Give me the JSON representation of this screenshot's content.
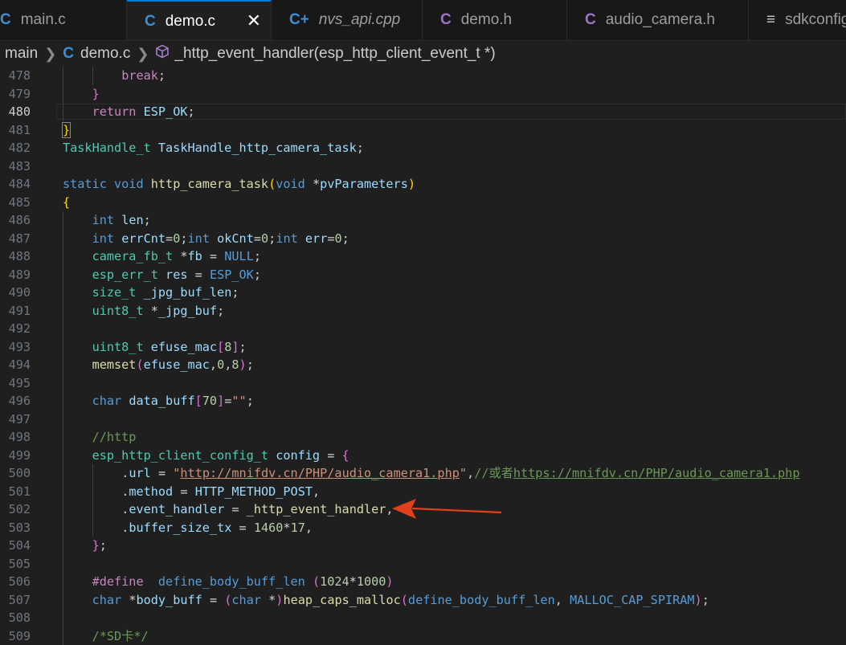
{
  "tabs": [
    {
      "label": "main.c",
      "icon": "C",
      "icon_color": "#3b8fd6",
      "italic": false,
      "active": false
    },
    {
      "label": "demo.c",
      "icon": "C",
      "icon_color": "#3b8fd6",
      "italic": false,
      "active": true
    },
    {
      "label": "nvs_api.cpp",
      "icon": "C+",
      "icon_color": "#3b8fd6",
      "italic": true,
      "active": false
    },
    {
      "label": "demo.h",
      "icon": "C",
      "icon_color": "#a074c4",
      "italic": false,
      "active": false
    },
    {
      "label": "audio_camera.h",
      "icon": "C",
      "icon_color": "#a074c4",
      "italic": false,
      "active": false
    },
    {
      "label": "sdkconfig",
      "icon": "≡",
      "icon_color": "#cccccc",
      "italic": false,
      "active": false
    }
  ],
  "breadcrumb": {
    "folder": "main",
    "file_icon": "C",
    "file": "demo.c",
    "symbol": "_http_event_handler(esp_http_client_event_t *)"
  },
  "current_line": 480,
  "lines": [
    {
      "n": 478,
      "indent": 2,
      "tokens": [
        [
          "ctl",
          "break"
        ],
        [
          "p",
          ";"
        ]
      ]
    },
    {
      "n": 479,
      "indent": 1,
      "tokens": [
        [
          "b2",
          "}"
        ]
      ]
    },
    {
      "n": 480,
      "indent": 1,
      "tokens": [
        [
          "ctl",
          "return"
        ],
        [
          "p",
          " "
        ],
        [
          "var",
          "ESP_OK"
        ],
        [
          "p",
          ";"
        ]
      ]
    },
    {
      "n": 481,
      "indent": 0,
      "tokens": [
        [
          "b1",
          "}"
        ]
      ]
    },
    {
      "n": 482,
      "indent": 0,
      "tokens": [
        [
          "ty",
          "TaskHandle_t"
        ],
        [
          "p",
          " "
        ],
        [
          "var",
          "TaskHandle_http_camera_task"
        ],
        [
          "p",
          ";"
        ]
      ]
    },
    {
      "n": 483,
      "indent": 0,
      "tokens": []
    },
    {
      "n": 484,
      "indent": 0,
      "tokens": [
        [
          "kw",
          "static"
        ],
        [
          "p",
          " "
        ],
        [
          "kw",
          "void"
        ],
        [
          "p",
          " "
        ],
        [
          "fn",
          "http_camera_task"
        ],
        [
          "b1",
          "("
        ],
        [
          "kw",
          "void"
        ],
        [
          "p",
          " "
        ],
        [
          "op",
          "*"
        ],
        [
          "var",
          "pvParameters"
        ],
        [
          "b1",
          ")"
        ]
      ]
    },
    {
      "n": 485,
      "indent": 0,
      "tokens": [
        [
          "b1",
          "{"
        ]
      ]
    },
    {
      "n": 486,
      "indent": 1,
      "tokens": [
        [
          "kw",
          "int"
        ],
        [
          "p",
          " "
        ],
        [
          "var",
          "len"
        ],
        [
          "p",
          ";"
        ]
      ]
    },
    {
      "n": 487,
      "indent": 1,
      "tokens": [
        [
          "kw",
          "int"
        ],
        [
          "p",
          " "
        ],
        [
          "var",
          "errCnt"
        ],
        [
          "op",
          "="
        ],
        [
          "num",
          "0"
        ],
        [
          "p",
          ";"
        ],
        [
          "kw",
          "int"
        ],
        [
          "p",
          " "
        ],
        [
          "var",
          "okCnt"
        ],
        [
          "op",
          "="
        ],
        [
          "num",
          "0"
        ],
        [
          "p",
          ";"
        ],
        [
          "kw",
          "int"
        ],
        [
          "p",
          " "
        ],
        [
          "var",
          "err"
        ],
        [
          "op",
          "="
        ],
        [
          "num",
          "0"
        ],
        [
          "p",
          ";"
        ]
      ]
    },
    {
      "n": 488,
      "indent": 1,
      "tokens": [
        [
          "ty",
          "camera_fb_t"
        ],
        [
          "p",
          " "
        ],
        [
          "op",
          "*"
        ],
        [
          "var",
          "fb"
        ],
        [
          "p",
          " "
        ],
        [
          "op",
          "="
        ],
        [
          "p",
          " "
        ],
        [
          "kw",
          "NULL"
        ],
        [
          "p",
          ";"
        ]
      ]
    },
    {
      "n": 489,
      "indent": 1,
      "tokens": [
        [
          "ty",
          "esp_err_t"
        ],
        [
          "p",
          " "
        ],
        [
          "var",
          "res"
        ],
        [
          "p",
          " "
        ],
        [
          "op",
          "="
        ],
        [
          "p",
          " "
        ],
        [
          "kw",
          "ESP_OK"
        ],
        [
          "p",
          ";"
        ]
      ]
    },
    {
      "n": 490,
      "indent": 1,
      "tokens": [
        [
          "ty",
          "size_t"
        ],
        [
          "p",
          " "
        ],
        [
          "var",
          "_jpg_buf_len"
        ],
        [
          "p",
          ";"
        ]
      ]
    },
    {
      "n": 491,
      "indent": 1,
      "tokens": [
        [
          "ty",
          "uint8_t"
        ],
        [
          "p",
          " "
        ],
        [
          "op",
          "*"
        ],
        [
          "var",
          "_jpg_buf"
        ],
        [
          "p",
          ";"
        ]
      ]
    },
    {
      "n": 492,
      "indent": 1,
      "tokens": []
    },
    {
      "n": 493,
      "indent": 1,
      "tokens": [
        [
          "ty",
          "uint8_t"
        ],
        [
          "p",
          " "
        ],
        [
          "var",
          "efuse_mac"
        ],
        [
          "b2",
          "["
        ],
        [
          "num",
          "8"
        ],
        [
          "b2",
          "]"
        ],
        [
          "p",
          ";"
        ]
      ]
    },
    {
      "n": 494,
      "indent": 1,
      "tokens": [
        [
          "fn",
          "memset"
        ],
        [
          "b2",
          "("
        ],
        [
          "var",
          "efuse_mac"
        ],
        [
          "p",
          ","
        ],
        [
          "num",
          "0"
        ],
        [
          "p",
          ","
        ],
        [
          "num",
          "8"
        ],
        [
          "b2",
          ")"
        ],
        [
          "p",
          ";"
        ]
      ]
    },
    {
      "n": 495,
      "indent": 1,
      "tokens": []
    },
    {
      "n": 496,
      "indent": 1,
      "tokens": [
        [
          "kw",
          "char"
        ],
        [
          "p",
          " "
        ],
        [
          "var",
          "data_buff"
        ],
        [
          "b2",
          "["
        ],
        [
          "num",
          "70"
        ],
        [
          "b2",
          "]"
        ],
        [
          "op",
          "="
        ],
        [
          "str",
          "\"\""
        ],
        [
          "p",
          ";"
        ]
      ]
    },
    {
      "n": 497,
      "indent": 1,
      "tokens": []
    },
    {
      "n": 498,
      "indent": 1,
      "tokens": [
        [
          "cmt",
          "//http"
        ]
      ]
    },
    {
      "n": 499,
      "indent": 1,
      "tokens": [
        [
          "ty",
          "esp_http_client_config_t"
        ],
        [
          "p",
          " "
        ],
        [
          "var",
          "config"
        ],
        [
          "p",
          " "
        ],
        [
          "op",
          "="
        ],
        [
          "p",
          " "
        ],
        [
          "b2",
          "{"
        ]
      ]
    },
    {
      "n": 500,
      "indent": 2,
      "tokens": [
        [
          "p",
          "."
        ],
        [
          "var",
          "url"
        ],
        [
          "p",
          " "
        ],
        [
          "op",
          "="
        ],
        [
          "p",
          " "
        ],
        [
          "str",
          "\""
        ],
        [
          "url",
          "http://mnifdv.cn/PHP/audio_camera1.php"
        ],
        [
          "str",
          "\""
        ],
        [
          "p",
          ","
        ],
        [
          "cmt",
          "//或者"
        ],
        [
          "cmturl",
          "https://mnifdv.cn/PHP/audio_camera1.php"
        ]
      ]
    },
    {
      "n": 501,
      "indent": 2,
      "tokens": [
        [
          "p",
          "."
        ],
        [
          "var",
          "method"
        ],
        [
          "p",
          " "
        ],
        [
          "op",
          "="
        ],
        [
          "p",
          " "
        ],
        [
          "var",
          "HTTP_METHOD_POST"
        ],
        [
          "p",
          ","
        ]
      ]
    },
    {
      "n": 502,
      "indent": 2,
      "tokens": [
        [
          "p",
          "."
        ],
        [
          "var",
          "event_handler"
        ],
        [
          "p",
          " "
        ],
        [
          "op",
          "="
        ],
        [
          "p",
          " "
        ],
        [
          "fn",
          "_http_event_handler"
        ],
        [
          "p",
          ","
        ]
      ]
    },
    {
      "n": 503,
      "indent": 2,
      "tokens": [
        [
          "p",
          "."
        ],
        [
          "var",
          "buffer_size_tx"
        ],
        [
          "p",
          " "
        ],
        [
          "op",
          "="
        ],
        [
          "p",
          " "
        ],
        [
          "num",
          "1460"
        ],
        [
          "op",
          "*"
        ],
        [
          "num",
          "17"
        ],
        [
          "p",
          ","
        ]
      ]
    },
    {
      "n": 504,
      "indent": 1,
      "tokens": [
        [
          "b2",
          "}"
        ],
        [
          "p",
          ";"
        ]
      ]
    },
    {
      "n": 505,
      "indent": 1,
      "tokens": []
    },
    {
      "n": 506,
      "indent": 1,
      "tokens": [
        [
          "ctl",
          "#define"
        ],
        [
          "p",
          "  "
        ],
        [
          "kw",
          "define_body_buff_len"
        ],
        [
          "p",
          " "
        ],
        [
          "b2",
          "("
        ],
        [
          "num",
          "1024"
        ],
        [
          "op",
          "*"
        ],
        [
          "num",
          "1000"
        ],
        [
          "b2",
          ")"
        ]
      ]
    },
    {
      "n": 507,
      "indent": 1,
      "tokens": [
        [
          "kw",
          "char"
        ],
        [
          "p",
          " "
        ],
        [
          "op",
          "*"
        ],
        [
          "var",
          "body_buff"
        ],
        [
          "p",
          " "
        ],
        [
          "op",
          "="
        ],
        [
          "p",
          " "
        ],
        [
          "b2",
          "("
        ],
        [
          "kw",
          "char"
        ],
        [
          "p",
          " "
        ],
        [
          "op",
          "*"
        ],
        [
          "b2",
          ")"
        ],
        [
          "fn",
          "heap_caps_malloc"
        ],
        [
          "b2",
          "("
        ],
        [
          "kw",
          "define_body_buff_len"
        ],
        [
          "p",
          ", "
        ],
        [
          "kw",
          "MALLOC_CAP_SPIRAM"
        ],
        [
          "b2",
          ")"
        ],
        [
          "p",
          ";"
        ]
      ]
    },
    {
      "n": 508,
      "indent": 1,
      "tokens": []
    },
    {
      "n": 509,
      "indent": 1,
      "tokens": [
        [
          "cmt",
          "/*SD卡*/"
        ]
      ]
    }
  ],
  "colors": {
    "arrow": "#e0401c",
    "accent": "#0078d4"
  },
  "icons": {
    "close": "close-icon",
    "symbol": "cube-icon",
    "chevron": "chevron-right-icon"
  }
}
